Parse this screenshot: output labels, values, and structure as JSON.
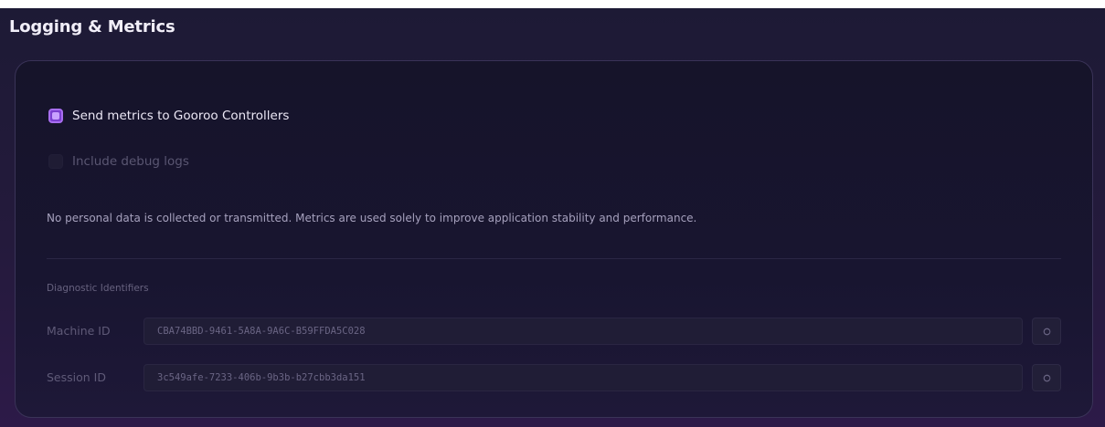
{
  "panel": {
    "title": "Logging & Metrics"
  },
  "options": {
    "send_metrics": {
      "label": "Send metrics to Gooroo Controllers",
      "checked": true
    },
    "debug_logs": {
      "label": "Include debug logs",
      "checked": false,
      "disabled": true
    }
  },
  "privacy_note": "No personal data is collected or transmitted. Metrics are used solely to improve application stability and performance.",
  "diagnostics": {
    "section_label": "Diagnostic Identifiers",
    "machine": {
      "label": "Machine ID",
      "value": "CBA74BBD-9461-5A8A-9A6C-B59FFDA5C028",
      "copy_icon": "copy-icon"
    },
    "session": {
      "label": "Session ID",
      "value": "3c549afe-7233-406b-9b3b-b27cbb3da151",
      "copy_icon": "copy-icon"
    }
  },
  "colors": {
    "accent": "#7b3fd0",
    "accent_light": "#a86ef0"
  }
}
